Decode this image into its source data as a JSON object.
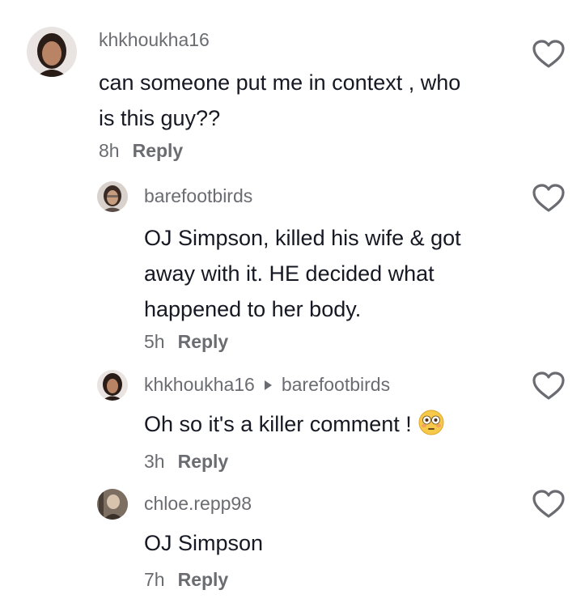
{
  "comments": [
    {
      "username": "khkhoukha16",
      "text_lines": [
        "can someone put me in context , who",
        "is this guy??"
      ],
      "time": "8h",
      "reply_label": "Reply"
    },
    {
      "username": "barefootbirds",
      "text_lines": [
        "OJ Simpson, killed his wife & got",
        "away with it. HE decided what",
        "happened to her body."
      ],
      "time": "5h",
      "reply_label": "Reply"
    },
    {
      "username": "khkhoukha16",
      "reply_to": "barefootbirds",
      "text": "Oh so it's a killer comment !",
      "emoji": "flushed-face",
      "time": "3h",
      "reply_label": "Reply"
    },
    {
      "username": "chloe.repp98",
      "text": "OJ Simpson",
      "time": "7h",
      "reply_label": "Reply"
    }
  ],
  "icons": {
    "like": "heart-outline-icon",
    "reply_indicator": "triangle-right-icon"
  },
  "colors": {
    "text": "#161823",
    "secondary": "#6b6c72",
    "heart_stroke": "#6b6c72",
    "background": "#ffffff"
  }
}
